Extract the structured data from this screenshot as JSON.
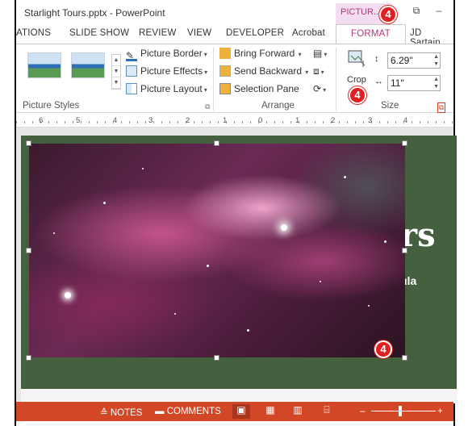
{
  "window": {
    "title": "Starlight Tours.pptx - PowerPoint",
    "context_tab_label": "PICTUR...",
    "minimize": "–",
    "restore": "⧉"
  },
  "tabs": [
    {
      "label": "ATIONS"
    },
    {
      "label": "SLIDE SHOW"
    },
    {
      "label": "REVIEW"
    },
    {
      "label": "VIEW"
    },
    {
      "label": "DEVELOPER"
    },
    {
      "label": "Acrobat"
    },
    {
      "label": "FORMAT",
      "active": true
    },
    {
      "label": "JD Sartain"
    }
  ],
  "ribbon": {
    "picture_styles": {
      "label": "Picture Styles",
      "border": "Picture Border",
      "effects": "Picture Effects",
      "layout": "Picture Layout"
    },
    "arrange": {
      "label": "Arrange",
      "bring_forward": "Bring Forward",
      "send_backward": "Send Backward",
      "selection_pane": "Selection Pane"
    },
    "size": {
      "label": "Size",
      "crop": "Crop",
      "height": "6.29\"",
      "width": "11\""
    }
  },
  "ruler": [
    "6",
    "5",
    "4",
    "3",
    "2",
    "1",
    "0",
    "1",
    "2",
    "3",
    "4"
  ],
  "slide": {
    "title_fragment": "rs",
    "subtitle_fragment": "ula"
  },
  "callouts": [
    "4",
    "4",
    "4"
  ],
  "statusbar": {
    "notes": "NOTES",
    "comments": "COMMENTS",
    "zoom_minus": "–",
    "zoom_plus": "+"
  },
  "colors": {
    "accent": "#b0397e",
    "statusbar": "#d24726",
    "slide_bg": "#45603f",
    "badge": "#e02020"
  }
}
